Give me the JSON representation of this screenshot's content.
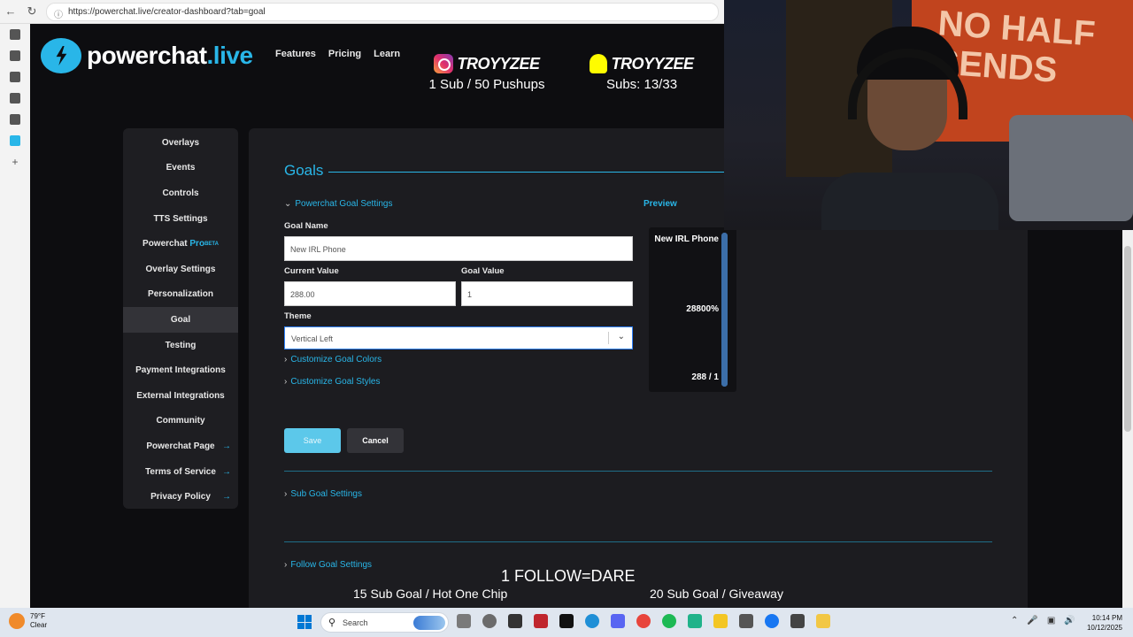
{
  "browser": {
    "url": "https://powerchat.live/creator-dashboard?tab=goal"
  },
  "site": {
    "logo_prefix": "powerchat",
    "logo_suffix": ".live",
    "nav": [
      "Features",
      "Pricing",
      "Learn"
    ]
  },
  "stream_overlay": {
    "instagram_handle": "TROYYZEE",
    "instagram_line": "1 Sub / 50 Pushups",
    "snapchat_handle": "TROYYZEE",
    "snapchat_line": "Subs: 13/33",
    "follow_text": "1 FOLLOW=DARE",
    "goal_left": "15 Sub Goal / Hot One Chip",
    "goal_right": "20 Sub Goal / Giveaway",
    "webcam_flag_text": "NO HALF SENDS"
  },
  "sidebar": {
    "items": [
      {
        "label": "Overlays"
      },
      {
        "label": "Events"
      },
      {
        "label": "Controls"
      },
      {
        "label": "TTS Settings"
      },
      {
        "label": "Powerchat ",
        "accent": "Pro",
        "sup": "BETA"
      },
      {
        "label": "Overlay Settings"
      },
      {
        "label": "Personalization"
      },
      {
        "label": "Goal",
        "active": true
      },
      {
        "label": "Testing"
      },
      {
        "label": "Payment Integrations"
      },
      {
        "label": "External Integrations"
      },
      {
        "label": "Community"
      },
      {
        "label": "Powerchat Page",
        "external": true
      },
      {
        "label": "Terms of Service",
        "external": true
      },
      {
        "label": "Privacy Policy",
        "external": true
      }
    ]
  },
  "goals": {
    "title": "Goals",
    "settings_toggle": "Powerchat Goal Settings",
    "preview_label": "Preview",
    "goal_name_label": "Goal Name",
    "goal_name_value": "New IRL Phone",
    "current_value_label": "Current Value",
    "current_value_value": "288.00",
    "goal_value_label": "Goal Value",
    "goal_value_value": "1",
    "theme_label": "Theme",
    "theme_value": "Vertical Left",
    "customize_colors": "Customize Goal Colors",
    "customize_styles": "Customize Goal Styles",
    "save_label": "Save",
    "cancel_label": "Cancel",
    "sub_goal_settings": "Sub Goal Settings",
    "follow_goal_settings": "Follow Goal Settings",
    "preview": {
      "name": "New IRL Phone",
      "percent": "28800%",
      "count": "288 / 1",
      "progress_fraction": 1.0
    }
  },
  "taskbar": {
    "temperature": "79°F",
    "condition": "Clear",
    "search_placeholder": "Search",
    "time": "10:14 PM",
    "date": "10/12/2025"
  },
  "colors": {
    "accent": "#29b6e8",
    "page_bg": "#0d0d10",
    "panel_bg": "#1c1c20"
  }
}
